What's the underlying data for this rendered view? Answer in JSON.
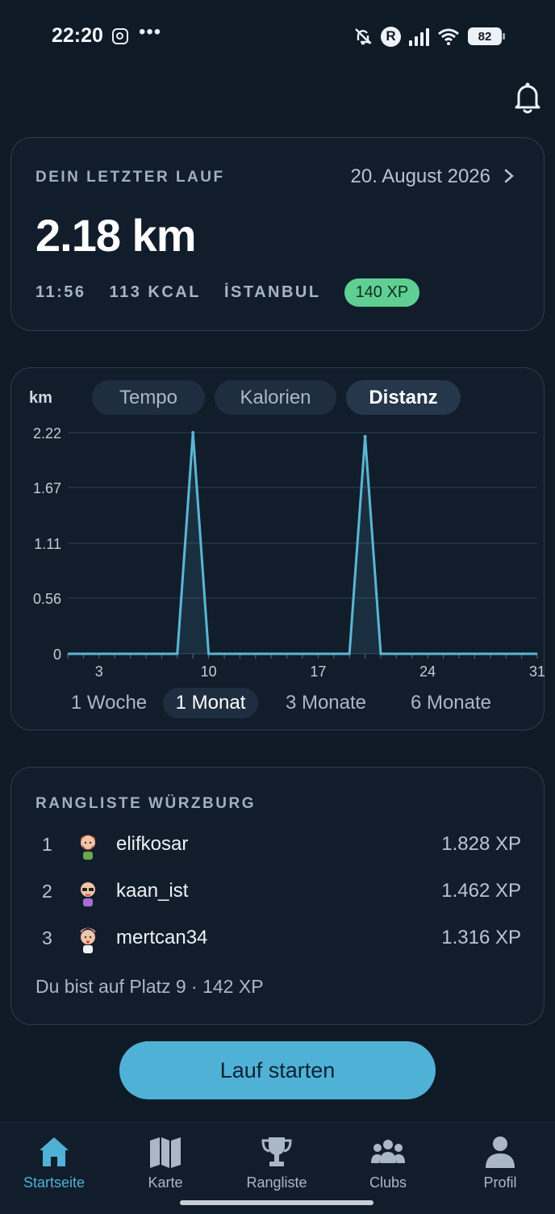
{
  "status_bar": {
    "time": "22:20",
    "dots": "•••",
    "r_badge": "R",
    "battery": "82"
  },
  "last_run": {
    "label": "DEIN LETZTER LAUF",
    "date": "20. August 2026",
    "distance": "2.18 km",
    "duration": "11:56",
    "calories": "113 KCAL",
    "city": "İSTANBUL",
    "xp": "140 XP"
  },
  "chart": {
    "unit": "km",
    "tabs": [
      "Tempo",
      "Kalorien",
      "Distanz"
    ],
    "active_tab": "Distanz",
    "ranges": [
      "1 Woche",
      "1 Monat",
      "3 Monate",
      "6 Monate"
    ],
    "active_range": "1 Monat",
    "colors": {
      "line": "#5bb6d3",
      "grid": "#24344a",
      "axis": "#5b6b7c"
    }
  },
  "chart_data": {
    "type": "area",
    "x": [
      1,
      2,
      3,
      4,
      5,
      6,
      7,
      8,
      9,
      10,
      11,
      12,
      13,
      14,
      15,
      16,
      17,
      18,
      19,
      20,
      21,
      22,
      23,
      24,
      25,
      26,
      27,
      28,
      29,
      30,
      31
    ],
    "values": [
      0,
      0,
      0,
      0,
      0,
      0,
      0,
      0,
      2.22,
      0,
      0,
      0,
      0,
      0,
      0,
      0,
      0,
      0,
      0,
      2.18,
      0,
      0,
      0,
      0,
      0,
      0,
      0,
      0,
      0,
      0,
      0
    ],
    "x_ticks": [
      "3",
      "10",
      "17",
      "24",
      "31"
    ],
    "y_ticks": [
      "0",
      "0.56",
      "1.11",
      "1.67",
      "2.22"
    ],
    "ylim": [
      0,
      2.22
    ],
    "ylabel": "km",
    "grid": true
  },
  "leaderboard": {
    "title": "RANGLISTE WÜRZBURG",
    "rows": [
      {
        "pos": "1",
        "name": "elifkosar",
        "xp": "1.828 XP"
      },
      {
        "pos": "2",
        "name": "kaan_ist",
        "xp": "1.462 XP"
      },
      {
        "pos": "3",
        "name": "mertcan34",
        "xp": "1.316 XP"
      }
    ],
    "self": "Du bist auf Platz 9 · 142 XP"
  },
  "start_button": "Lauf starten",
  "nav": [
    {
      "label": "Startseite",
      "icon": "home-icon",
      "active": true
    },
    {
      "label": "Karte",
      "icon": "map-icon",
      "active": false
    },
    {
      "label": "Rangliste",
      "icon": "trophy-icon",
      "active": false
    },
    {
      "label": "Clubs",
      "icon": "group-icon",
      "active": false
    },
    {
      "label": "Profil",
      "icon": "person-icon",
      "active": false
    }
  ]
}
